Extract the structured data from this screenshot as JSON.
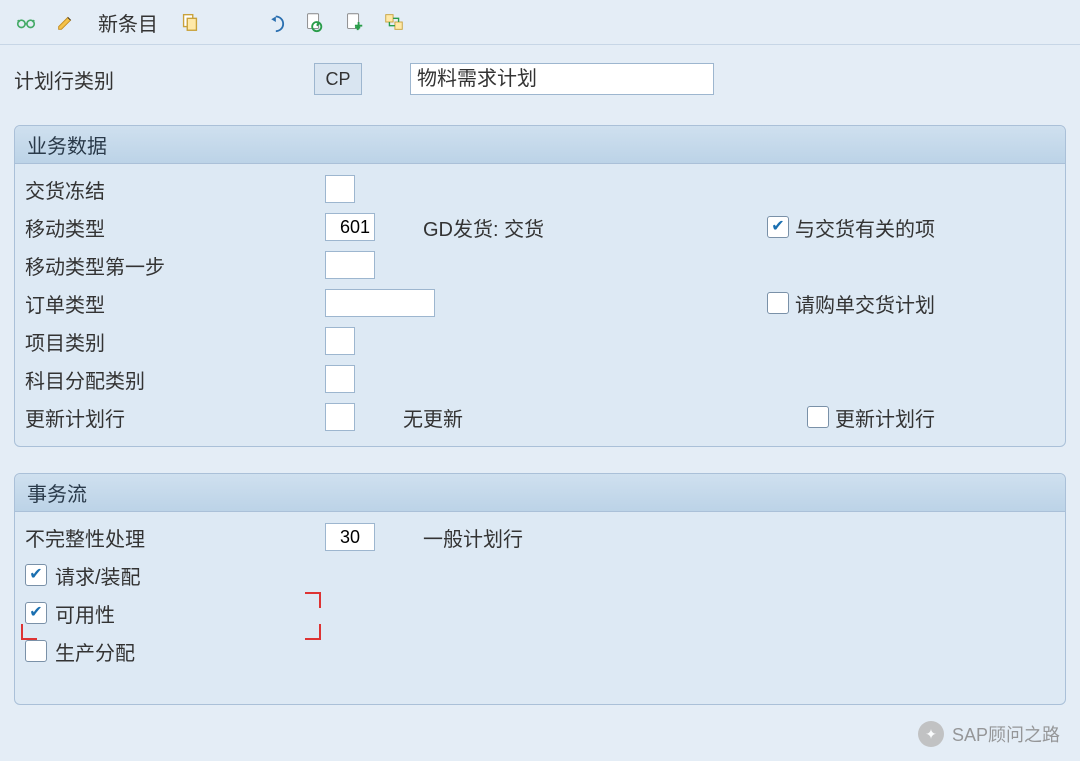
{
  "toolbar": {
    "new_entry": "新条目"
  },
  "header": {
    "label": "计划行类别",
    "code": "CP",
    "desc": "物料需求计划"
  },
  "business": {
    "title": "业务数据",
    "delivery_block": {
      "label": "交货冻结",
      "value": ""
    },
    "movement_type": {
      "label": "移动类型",
      "value": "601",
      "text": "GD发货: 交货"
    },
    "delivery_relevant": {
      "label": "与交货有关的项",
      "checked": true
    },
    "movement_type_step1": {
      "label": "移动类型第一步",
      "value": ""
    },
    "order_type": {
      "label": "订单类型",
      "value": ""
    },
    "preq_sched": {
      "label": "请购单交货计划",
      "checked": false
    },
    "item_category": {
      "label": "项目类别",
      "value": ""
    },
    "acct_assign_cat": {
      "label": "科目分配类别",
      "value": ""
    },
    "update_sched": {
      "label": "更新计划行",
      "value": "",
      "text": "无更新"
    },
    "update_sched_chk": {
      "label": "更新计划行",
      "checked": false
    }
  },
  "transaction": {
    "title": "事务流",
    "incompleteness": {
      "label": "不完整性处理",
      "value": "30",
      "text": "一般计划行"
    },
    "req_assembly": {
      "label": "请求/装配",
      "checked": true
    },
    "availability": {
      "label": "可用性",
      "checked": true
    },
    "prod_alloc": {
      "label": "生产分配",
      "checked": false
    }
  },
  "watermark": "SAP顾问之路"
}
